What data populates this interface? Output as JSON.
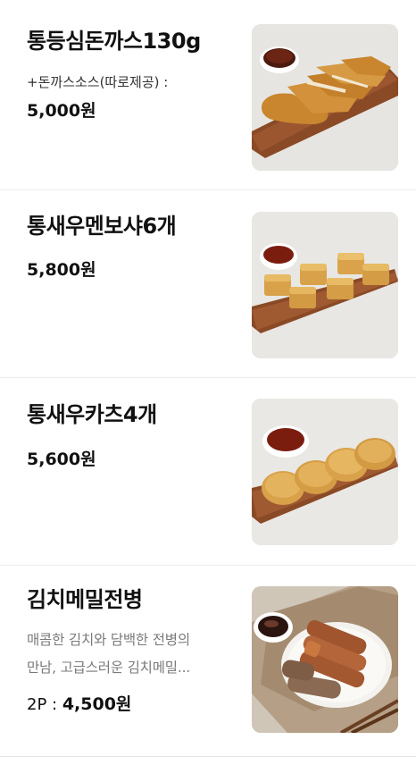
{
  "items": [
    {
      "name": "통등심돈까스130g",
      "desc": "+돈까스소스(따로제공) :",
      "price": "5,000원",
      "image": "pork-cutlet-image"
    },
    {
      "name": "통새우멘보샤6개",
      "price": "5,800원",
      "image": "shrimp-menbosha-image"
    },
    {
      "name": "통새우카츠4개",
      "price": "5,600원",
      "image": "shrimp-katsu-image"
    },
    {
      "name": "김치메밀전병",
      "desc_line1": "매콤한 김치와 담백한 전병의",
      "desc_line2": "만남, 고급스러운 김치메밀...",
      "qty": "2P :",
      "price": "4,500원",
      "image": "kimchi-buckwheat-crepe-image"
    }
  ]
}
